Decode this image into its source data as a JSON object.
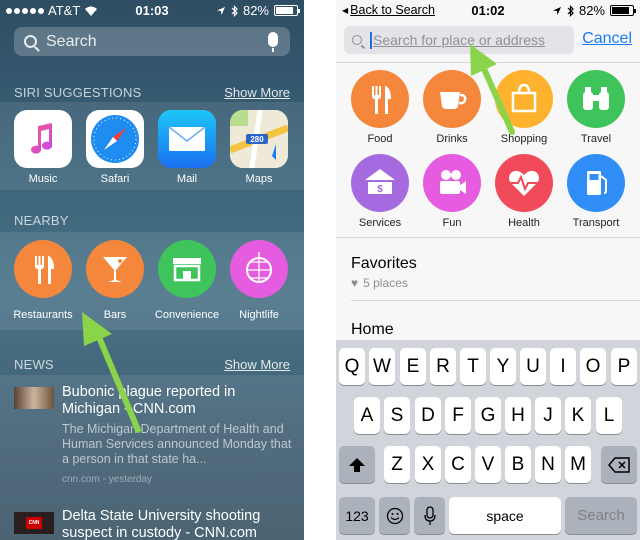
{
  "left": {
    "status": {
      "carrier": "AT&T",
      "time": "01:03",
      "battery": "82%"
    },
    "search_placeholder": "Search",
    "siri": {
      "header": "SIRI SUGGESTIONS",
      "show_more": "Show More",
      "apps": [
        {
          "label": "Music",
          "icon": "music-icon"
        },
        {
          "label": "Safari",
          "icon": "compass-icon"
        },
        {
          "label": "Mail",
          "icon": "envelope-icon"
        },
        {
          "label": "Maps",
          "icon": "map-icon",
          "badge": "280"
        }
      ]
    },
    "nearby": {
      "header": "NEARBY",
      "items": [
        {
          "label": "Restaurants",
          "icon": "fork-knife-icon",
          "color": "#f5873d"
        },
        {
          "label": "Bars",
          "icon": "cocktail-icon",
          "color": "#f5873d"
        },
        {
          "label": "Convenience",
          "icon": "store-icon",
          "color": "#3ec45a"
        },
        {
          "label": "Nightlife",
          "icon": "disco-ball-icon",
          "color": "#e65ce0"
        }
      ]
    },
    "news": {
      "header": "NEWS",
      "show_more": "Show More",
      "items": [
        {
          "title": "Bubonic plague reported in Michigan - CNN.com",
          "body": "The Michigan Department of Health and Human Services announced Monday that a person in that state ha...",
          "meta": "cnn.com - yesterday"
        },
        {
          "title": "Delta State University shooting suspect in custody - CNN.com",
          "thumb_label": "CNN"
        }
      ]
    }
  },
  "right": {
    "status": {
      "back": "Back to Search",
      "time": "01:02",
      "battery": "82%"
    },
    "search_placeholder": "Search for place or address",
    "cancel": "Cancel",
    "categories": [
      {
        "label": "Food",
        "icon": "fork-knife-icon",
        "color": "#f5873d"
      },
      {
        "label": "Drinks",
        "icon": "coffee-cup-icon",
        "color": "#f5873d"
      },
      {
        "label": "Shopping",
        "icon": "shopping-bag-icon",
        "color": "#ffb22e"
      },
      {
        "label": "Travel",
        "icon": "binoculars-icon",
        "color": "#3ec45a"
      },
      {
        "label": "Services",
        "icon": "bank-icon",
        "color": "#a56ae0"
      },
      {
        "label": "Fun",
        "icon": "camera-icon",
        "color": "#e65ce0"
      },
      {
        "label": "Health",
        "icon": "heart-pulse-icon",
        "color": "#f14a5a"
      },
      {
        "label": "Transport",
        "icon": "fuel-pump-icon",
        "color": "#2f8df5"
      }
    ],
    "favorites": {
      "title": "Favorites",
      "subtitle": "5 places"
    },
    "home": "Home",
    "keyboard": {
      "row1": [
        "Q",
        "W",
        "E",
        "R",
        "T",
        "Y",
        "U",
        "I",
        "O",
        "P"
      ],
      "row2": [
        "A",
        "S",
        "D",
        "F",
        "G",
        "H",
        "J",
        "K",
        "L"
      ],
      "row3": [
        "Z",
        "X",
        "C",
        "V",
        "B",
        "N",
        "M"
      ],
      "numbers": "123",
      "space": "space",
      "search": "Search"
    }
  },
  "colors": {
    "arrow": "#8bd34a",
    "link": "#1a7cf5"
  }
}
